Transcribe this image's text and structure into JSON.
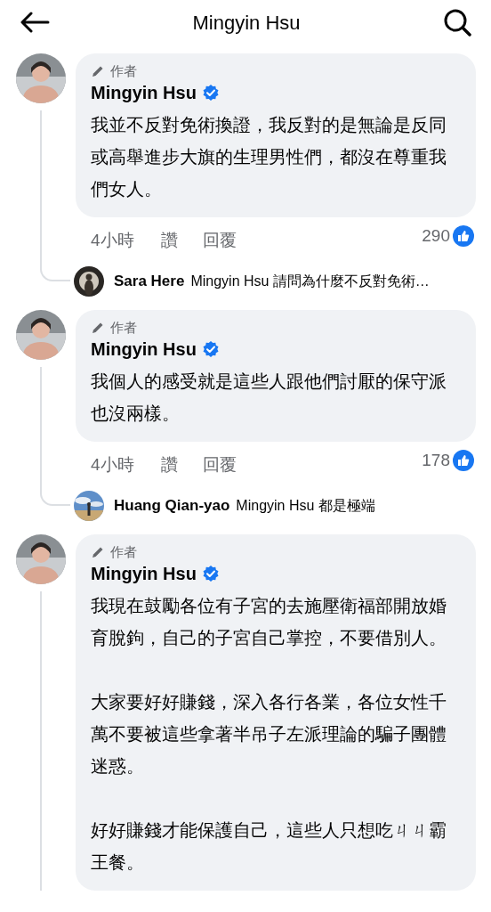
{
  "header": {
    "title": "Mingyin Hsu"
  },
  "comments": [
    {
      "badge": "作者",
      "author": "Mingyin Hsu",
      "verified": true,
      "paragraphs": [
        "我並不反對免術換證，我反對的是無論是反同或高舉進步大旗的生理男性們，都沒在尊重我們女人。"
      ],
      "time": "4小時",
      "like": "讚",
      "reply": "回覆",
      "reactions": "290",
      "reply_preview": {
        "author": "Sara Here",
        "text": "Mingyin Hsu 請問為什麼不反對免術…"
      }
    },
    {
      "badge": "作者",
      "author": "Mingyin Hsu",
      "verified": true,
      "paragraphs": [
        "我個人的感受就是這些人跟他們討厭的保守派也沒兩樣。"
      ],
      "time": "4小時",
      "like": "讚",
      "reply": "回覆",
      "reactions": "178",
      "reply_preview": {
        "author": "Huang Qian-yao",
        "text": "Mingyin Hsu 都是極端"
      }
    },
    {
      "badge": "作者",
      "author": "Mingyin Hsu",
      "verified": true,
      "paragraphs": [
        "我現在鼓勵各位有子宮的去施壓衛福部開放婚育脫鉤，自己的子宮自己掌控，不要借別人。",
        "大家要好好賺錢，深入各行各業，各位女性千萬不要被這些拿著半吊子左派理論的騙子團體迷惑。",
        "好好賺錢才能保護自己，這些人只想吃ㄐㄐ霸王餐。"
      ]
    }
  ]
}
